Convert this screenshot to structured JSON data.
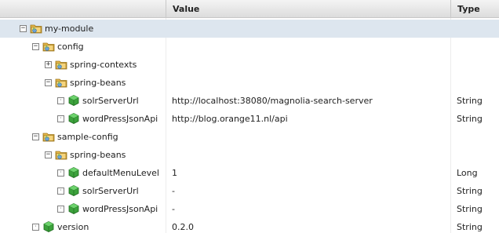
{
  "header": {
    "col_value": "Value",
    "col_type": "Type"
  },
  "rows": [
    {
      "label": "my-module",
      "value": "",
      "type": "",
      "toggle": "−",
      "icon": "folder-icon",
      "depth": 0
    },
    {
      "label": "config",
      "value": "",
      "type": "",
      "toggle": "−",
      "icon": "folder-icon",
      "depth": 1
    },
    {
      "label": "spring-contexts",
      "value": "",
      "type": "",
      "toggle": "+",
      "icon": "folder-icon",
      "depth": 2
    },
    {
      "label": "spring-beans",
      "value": "",
      "type": "",
      "toggle": "−",
      "icon": "folder-icon",
      "depth": 2
    },
    {
      "label": "solrServerUrl",
      "value": "http://localhost:38080/magnolia-search-server",
      "type": "String",
      "toggle": "·",
      "icon": "property-icon",
      "depth": 3
    },
    {
      "label": "wordPressJsonApi",
      "value": "http://blog.orange11.nl/api",
      "type": "String",
      "toggle": "·",
      "icon": "property-icon",
      "depth": 3
    },
    {
      "label": "sample-config",
      "value": "",
      "type": "",
      "toggle": "−",
      "icon": "folder-icon",
      "depth": 1
    },
    {
      "label": "spring-beans",
      "value": "",
      "type": "",
      "toggle": "−",
      "icon": "folder-icon",
      "depth": 2
    },
    {
      "label": "defaultMenuLevel",
      "value": "1",
      "type": "Long",
      "toggle": "·",
      "icon": "property-icon",
      "depth": 3
    },
    {
      "label": "solrServerUrl",
      "value": "-",
      "type": "String",
      "toggle": "·",
      "icon": "property-icon",
      "depth": 3
    },
    {
      "label": "wordPressJsonApi",
      "value": "-",
      "type": "String",
      "toggle": "·",
      "icon": "property-icon",
      "depth": 3
    },
    {
      "label": "version",
      "value": "0.2.0",
      "type": "String",
      "toggle": "·",
      "icon": "property-icon",
      "depth": 1
    }
  ],
  "colors": {
    "selected_row": "#dde6ef",
    "folder": "#e8b94a",
    "property": "#3ca23c"
  }
}
